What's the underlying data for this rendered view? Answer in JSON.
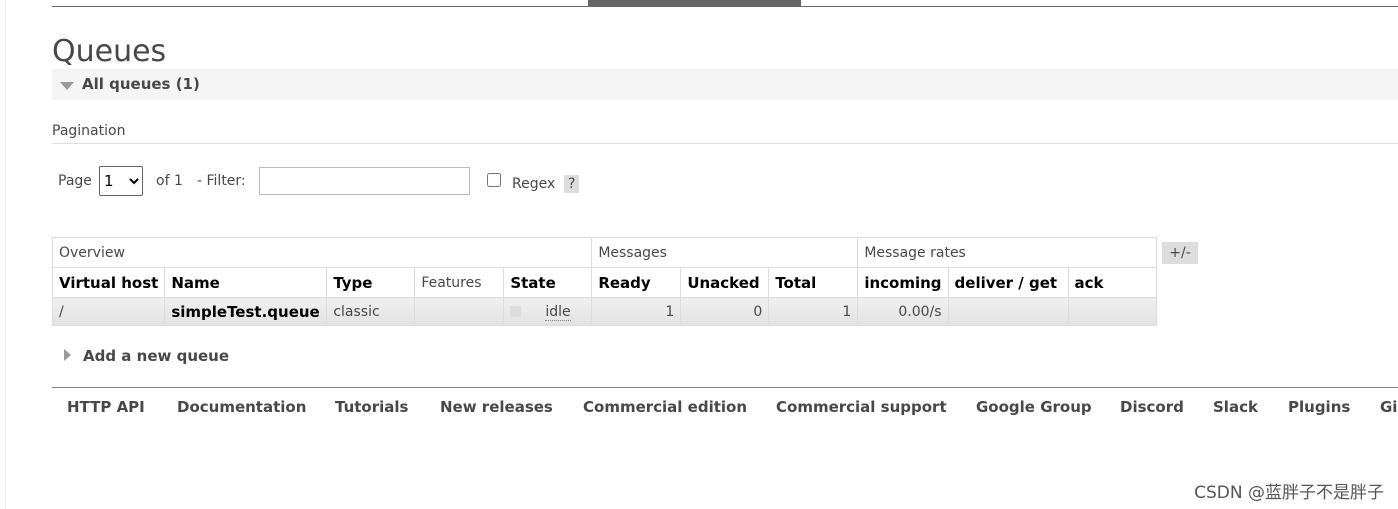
{
  "title": "Queues",
  "section": "All queues (1)",
  "pagination": {
    "label": "Pagination",
    "page_label": "Page",
    "page_value": "1",
    "of_label": "of 1",
    "filter_label": "- Filter:",
    "filter_value": "",
    "regex_label": "Regex",
    "help": "?"
  },
  "table": {
    "groups": [
      "Overview",
      "Messages",
      "Message rates"
    ],
    "columns": [
      "Virtual host",
      "Name",
      "Type",
      "Features",
      "State",
      "Ready",
      "Unacked",
      "Total",
      "incoming",
      "deliver / get",
      "ack"
    ],
    "rows": [
      {
        "vhost": "/",
        "name": "simpleTest.queue",
        "type": "classic",
        "features": "",
        "state": "idle",
        "ready": "1",
        "unacked": "0",
        "total": "1",
        "incoming": "0.00/s",
        "deliver_get": "",
        "ack": ""
      }
    ],
    "toggle": "+/-"
  },
  "add_queue": "Add a new queue",
  "footer": [
    "HTTP API",
    "Documentation",
    "Tutorials",
    "New releases",
    "Commercial edition",
    "Commercial support",
    "Google Group",
    "Discord",
    "Slack",
    "Plugins",
    "Gi"
  ],
  "watermark": "CSDN @蓝胖子不是胖子"
}
